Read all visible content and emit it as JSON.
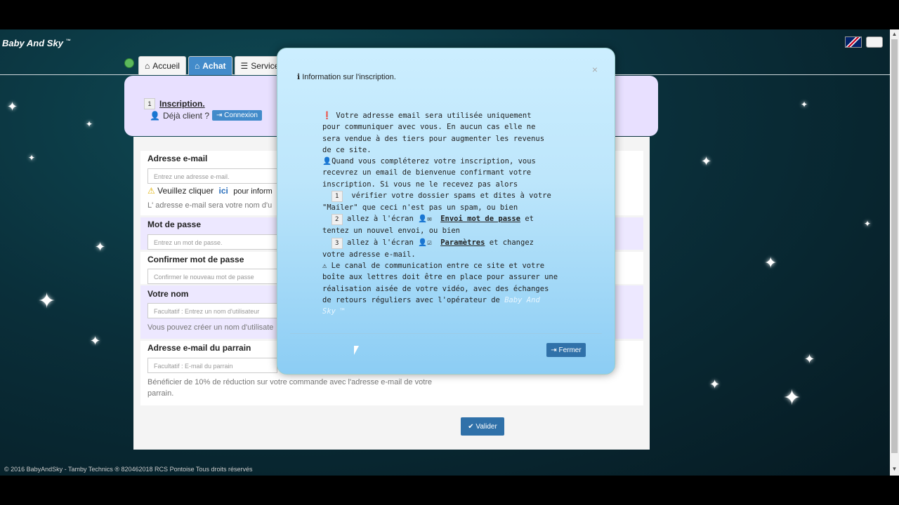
{
  "brand": {
    "name": "Baby And Sky",
    "tm": "™"
  },
  "nav": {
    "tabs": [
      "Accueil",
      "Achat",
      "Services"
    ]
  },
  "wizard": {
    "step_num": "1",
    "step_title": "Inscription.",
    "client_text": "Déjà client ?",
    "connexion_label": "Connexion"
  },
  "form": {
    "email_label": "Adresse e-mail",
    "email_placeholder": "Entrez une adresse e-mail.",
    "email_warning_prefix": "Veuillez cliquer",
    "email_warning_link": "ici",
    "email_warning_suffix": "pour inform",
    "email_help": "L' adresse e-mail sera votre nom d'u",
    "password_label": "Mot de passe",
    "password_placeholder": "Entrez un mot de passe.",
    "confirm_label": "Confirmer mot de passe",
    "confirm_placeholder": "Confirmer le nouveau mot de passe",
    "name_label": "Votre nom",
    "name_placeholder": "Facultatif : Entrez un nom d'utilisateur",
    "name_help": "Vous pouvez créer un nom d'utilisate",
    "sponsor_label": "Adresse e-mail du parrain",
    "sponsor_placeholder": "Facultatif : E-mail du parrain",
    "sponsor_help_1": "Bénéficier de 10% de réduction sur votre commande avec l'adresse e-mail de votre",
    "sponsor_help_2": "parrain.",
    "submit_label": "Valider"
  },
  "footer": {
    "text": "© 2016 BabyAndSky - Tamby Technics ® 820462018 RCS Pontoise Tous droits réservés"
  },
  "modal": {
    "title": "Information sur l'inscription.",
    "close": "×",
    "p1": "Votre adresse email sera utilisée uniquement\npour communiquer avec vous. En aucun cas elle ne\nsera vendue à des tiers pour augmenter les revenus\nde ce site.",
    "p2": "Quand vous compléterez votre inscription, vous\nrecevrez un email de bienvenue confirmant votre\ninscription. Si vous ne le recevez pas alors",
    "step1_num": "1",
    "step1": "vérifier votre dossier spams et dites à votre\n\"Mailer\" que ceci n'est pas un spam, ou bien",
    "step2_num": "2",
    "step2_pre": "allez à l'écran",
    "step2_link": "Envoi mot de passe",
    "step2_post": "et\ntentez un nouvel envoi, ou bien",
    "step3_num": "3",
    "step3_pre": "allez à l'écran",
    "step3_link": "Paramètres",
    "step3_post": "et changez\nvotre adresse e-mail.",
    "p3": "Le canal de communication entre ce site et votre\nboîte aux lettres doit être en place pour assurer une\nréalisation aisée de votre vidéo, avec des échanges\nde retours réguliers avec l'opérateur de",
    "p3_brand": "Baby And\nSky ™",
    "close_button": "Fermer"
  }
}
